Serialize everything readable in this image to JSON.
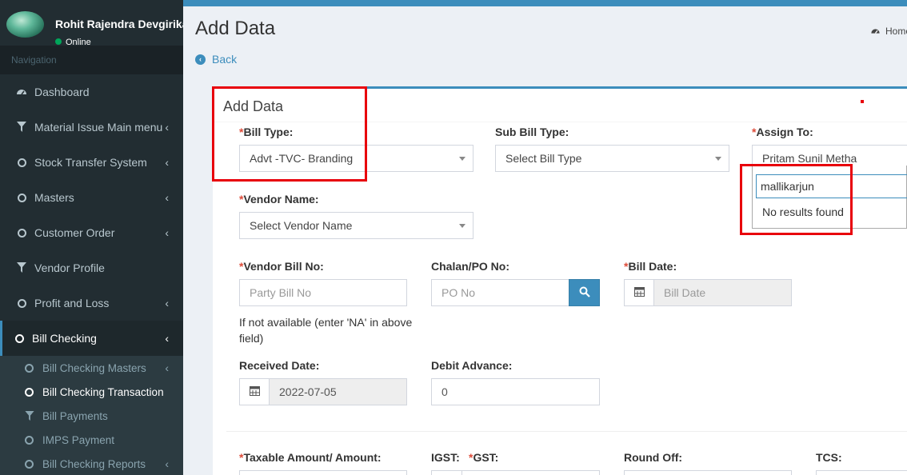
{
  "user": {
    "name": "Rohit Rajendra Devgirikar",
    "status": "Online"
  },
  "sidebar": {
    "header": "Navigation",
    "items": [
      {
        "label": "Dashboard",
        "icon": "dashboard-icon"
      },
      {
        "label": "Material Issue Main menu",
        "icon": "filter-icon"
      },
      {
        "label": "Stock Transfer System",
        "icon": "circle-icon"
      },
      {
        "label": "Masters",
        "icon": "circle-icon"
      },
      {
        "label": "Customer Order",
        "icon": "circle-icon"
      },
      {
        "label": "Vendor Profile",
        "icon": "filter-icon"
      },
      {
        "label": "Profit and Loss",
        "icon": "circle-icon"
      },
      {
        "label": "Bill Checking",
        "icon": "circle-icon"
      }
    ],
    "sub_items": [
      {
        "label": "Bill Checking Masters",
        "icon": "circle-icon"
      },
      {
        "label": "Bill Checking Transaction",
        "icon": "circle-icon"
      },
      {
        "label": "Bill Payments",
        "icon": "filter-icon"
      },
      {
        "label": "IMPS Payment",
        "icon": "circle-icon"
      },
      {
        "label": "Bill Checking Reports",
        "icon": "circle-icon"
      }
    ]
  },
  "header": {
    "title": "Add Data",
    "breadcrumb": "Home",
    "back": "Back"
  },
  "form": {
    "box_title": "Add Data",
    "required_mark": "*",
    "bill_type": {
      "label": "Bill Type:",
      "value": "Advt -TVC- Branding"
    },
    "sub_bill_type": {
      "label": "Sub Bill Type:",
      "value": "Select Bill Type"
    },
    "assign_to": {
      "label": "Assign To:",
      "value": "Pritam Sunil Metha",
      "search_value": "mallikarjun",
      "no_results": "No results found"
    },
    "vendor_name": {
      "label": "Vendor Name:",
      "value": "Select Vendor Name"
    },
    "vendor_bill_no": {
      "label": "Vendor Bill No:",
      "placeholder": "Party Bill No",
      "help_line1": "If not available (enter 'NA' in above",
      "help_line2": "field)"
    },
    "chalan_po_no": {
      "label": "Chalan/PO No:",
      "placeholder": "PO No"
    },
    "bill_date": {
      "label": "Bill Date:",
      "placeholder": "Bill Date"
    },
    "received_date": {
      "label": "Received Date:",
      "value": "2022-07-05"
    },
    "debit_advance": {
      "label": "Debit Advance:",
      "value": "0"
    },
    "taxable_amount": {
      "label": "Taxable Amount/ Amount:"
    },
    "igst": {
      "label": "IGST:"
    },
    "gst": {
      "label": "GST:"
    },
    "round_off": {
      "label": "Round Off:"
    },
    "tcs": {
      "label": "TCS:"
    }
  },
  "colors": {
    "accent": "#3c8dbc",
    "sidebar": "#222d32",
    "required": "#dd4b39",
    "annotation": "#e8000b"
  }
}
